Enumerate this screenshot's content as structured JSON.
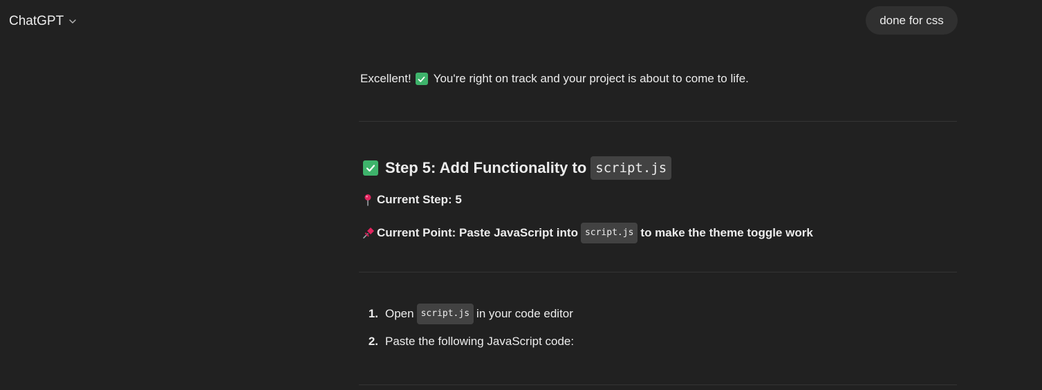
{
  "header": {
    "model_name": "ChatGPT",
    "chevron_icon": "chevron-down-icon"
  },
  "user_message": {
    "text": "done for css"
  },
  "assistant": {
    "intro_before": "Excellent!",
    "intro_after": "You're right on track and your project is about to come to life.",
    "step": {
      "heading": "Step 5: Add Functionality to",
      "heading_code": "script.js",
      "current_step_label": "Current Step: 5",
      "current_point_before": "Current Point: Paste JavaScript into",
      "current_point_code": "script.js",
      "current_point_after": "to make the theme toggle work"
    },
    "instructions": [
      {
        "num": "1.",
        "before": "Open",
        "code": "script.js",
        "after": "in your code editor"
      },
      {
        "num": "2.",
        "before": "Paste the following JavaScript code:",
        "code": "",
        "after": ""
      }
    ]
  },
  "colors": {
    "background": "#212121",
    "user_bubble": "#303030",
    "inline_code_bg": "#424242",
    "check_emoji": "#3eb36b",
    "pin_red": "#e0245e"
  }
}
